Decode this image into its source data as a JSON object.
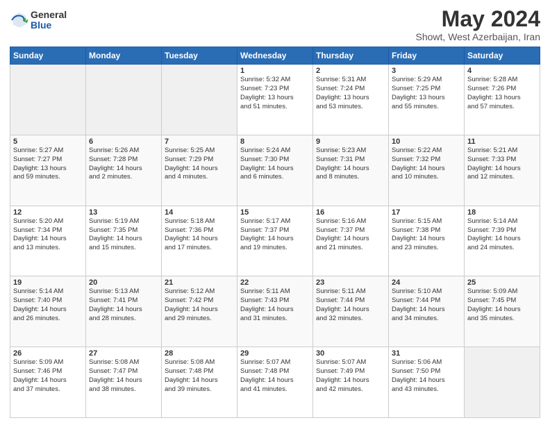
{
  "logo": {
    "general": "General",
    "blue": "Blue"
  },
  "title": "May 2024",
  "location": "Showt, West Azerbaijan, Iran",
  "weekdays": [
    "Sunday",
    "Monday",
    "Tuesday",
    "Wednesday",
    "Thursday",
    "Friday",
    "Saturday"
  ],
  "weeks": [
    [
      {
        "day": "",
        "info": ""
      },
      {
        "day": "",
        "info": ""
      },
      {
        "day": "",
        "info": ""
      },
      {
        "day": "1",
        "info": "Sunrise: 5:32 AM\nSunset: 7:23 PM\nDaylight: 13 hours\nand 51 minutes."
      },
      {
        "day": "2",
        "info": "Sunrise: 5:31 AM\nSunset: 7:24 PM\nDaylight: 13 hours\nand 53 minutes."
      },
      {
        "day": "3",
        "info": "Sunrise: 5:29 AM\nSunset: 7:25 PM\nDaylight: 13 hours\nand 55 minutes."
      },
      {
        "day": "4",
        "info": "Sunrise: 5:28 AM\nSunset: 7:26 PM\nDaylight: 13 hours\nand 57 minutes."
      }
    ],
    [
      {
        "day": "5",
        "info": "Sunrise: 5:27 AM\nSunset: 7:27 PM\nDaylight: 13 hours\nand 59 minutes."
      },
      {
        "day": "6",
        "info": "Sunrise: 5:26 AM\nSunset: 7:28 PM\nDaylight: 14 hours\nand 2 minutes."
      },
      {
        "day": "7",
        "info": "Sunrise: 5:25 AM\nSunset: 7:29 PM\nDaylight: 14 hours\nand 4 minutes."
      },
      {
        "day": "8",
        "info": "Sunrise: 5:24 AM\nSunset: 7:30 PM\nDaylight: 14 hours\nand 6 minutes."
      },
      {
        "day": "9",
        "info": "Sunrise: 5:23 AM\nSunset: 7:31 PM\nDaylight: 14 hours\nand 8 minutes."
      },
      {
        "day": "10",
        "info": "Sunrise: 5:22 AM\nSunset: 7:32 PM\nDaylight: 14 hours\nand 10 minutes."
      },
      {
        "day": "11",
        "info": "Sunrise: 5:21 AM\nSunset: 7:33 PM\nDaylight: 14 hours\nand 12 minutes."
      }
    ],
    [
      {
        "day": "12",
        "info": "Sunrise: 5:20 AM\nSunset: 7:34 PM\nDaylight: 14 hours\nand 13 minutes."
      },
      {
        "day": "13",
        "info": "Sunrise: 5:19 AM\nSunset: 7:35 PM\nDaylight: 14 hours\nand 15 minutes."
      },
      {
        "day": "14",
        "info": "Sunrise: 5:18 AM\nSunset: 7:36 PM\nDaylight: 14 hours\nand 17 minutes."
      },
      {
        "day": "15",
        "info": "Sunrise: 5:17 AM\nSunset: 7:37 PM\nDaylight: 14 hours\nand 19 minutes."
      },
      {
        "day": "16",
        "info": "Sunrise: 5:16 AM\nSunset: 7:37 PM\nDaylight: 14 hours\nand 21 minutes."
      },
      {
        "day": "17",
        "info": "Sunrise: 5:15 AM\nSunset: 7:38 PM\nDaylight: 14 hours\nand 23 minutes."
      },
      {
        "day": "18",
        "info": "Sunrise: 5:14 AM\nSunset: 7:39 PM\nDaylight: 14 hours\nand 24 minutes."
      }
    ],
    [
      {
        "day": "19",
        "info": "Sunrise: 5:14 AM\nSunset: 7:40 PM\nDaylight: 14 hours\nand 26 minutes."
      },
      {
        "day": "20",
        "info": "Sunrise: 5:13 AM\nSunset: 7:41 PM\nDaylight: 14 hours\nand 28 minutes."
      },
      {
        "day": "21",
        "info": "Sunrise: 5:12 AM\nSunset: 7:42 PM\nDaylight: 14 hours\nand 29 minutes."
      },
      {
        "day": "22",
        "info": "Sunrise: 5:11 AM\nSunset: 7:43 PM\nDaylight: 14 hours\nand 31 minutes."
      },
      {
        "day": "23",
        "info": "Sunrise: 5:11 AM\nSunset: 7:44 PM\nDaylight: 14 hours\nand 32 minutes."
      },
      {
        "day": "24",
        "info": "Sunrise: 5:10 AM\nSunset: 7:44 PM\nDaylight: 14 hours\nand 34 minutes."
      },
      {
        "day": "25",
        "info": "Sunrise: 5:09 AM\nSunset: 7:45 PM\nDaylight: 14 hours\nand 35 minutes."
      }
    ],
    [
      {
        "day": "26",
        "info": "Sunrise: 5:09 AM\nSunset: 7:46 PM\nDaylight: 14 hours\nand 37 minutes."
      },
      {
        "day": "27",
        "info": "Sunrise: 5:08 AM\nSunset: 7:47 PM\nDaylight: 14 hours\nand 38 minutes."
      },
      {
        "day": "28",
        "info": "Sunrise: 5:08 AM\nSunset: 7:48 PM\nDaylight: 14 hours\nand 39 minutes."
      },
      {
        "day": "29",
        "info": "Sunrise: 5:07 AM\nSunset: 7:48 PM\nDaylight: 14 hours\nand 41 minutes."
      },
      {
        "day": "30",
        "info": "Sunrise: 5:07 AM\nSunset: 7:49 PM\nDaylight: 14 hours\nand 42 minutes."
      },
      {
        "day": "31",
        "info": "Sunrise: 5:06 AM\nSunset: 7:50 PM\nDaylight: 14 hours\nand 43 minutes."
      },
      {
        "day": "",
        "info": ""
      }
    ]
  ]
}
